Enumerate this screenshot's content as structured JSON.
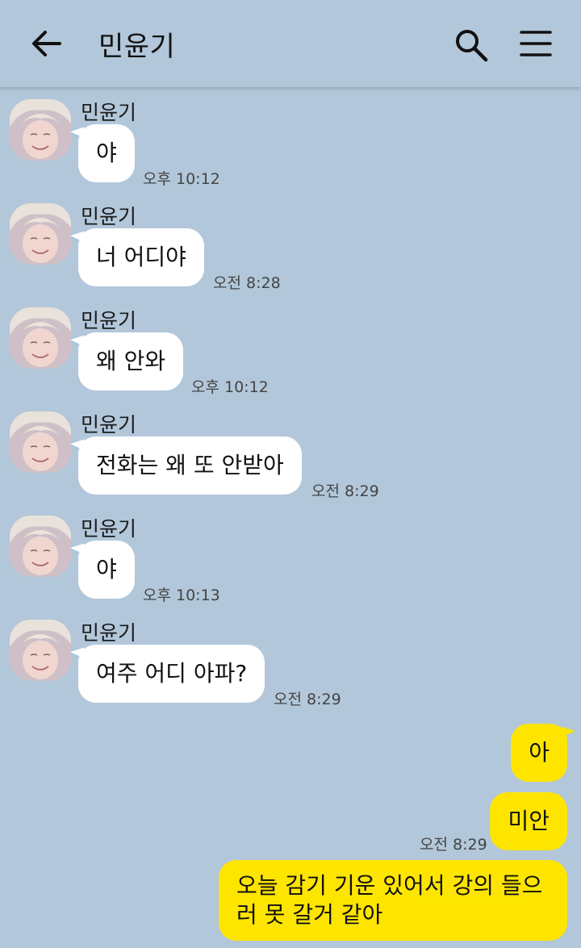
{
  "header": {
    "title": "민윤기"
  },
  "incoming": [
    {
      "sender": "민윤기",
      "text": "야",
      "time": "오후 10:12"
    },
    {
      "sender": "민윤기",
      "text": "너 어디야",
      "time": "오전 8:28"
    },
    {
      "sender": "민윤기",
      "text": "왜 안와",
      "time": "오후 10:12"
    },
    {
      "sender": "민윤기",
      "text": "전화는 왜 또 안받아",
      "time": "오전 8:29"
    },
    {
      "sender": "민윤기",
      "text": "야",
      "time": "오후 10:13"
    },
    {
      "sender": "민윤기",
      "text": "여주 어디 아파?",
      "time": "오전 8:29"
    }
  ],
  "outgoing": [
    {
      "text": "아"
    },
    {
      "text": "미안",
      "time": "오전 8:29"
    },
    {
      "text": "오늘 감기 기운 있어서 강의 들으러 못 갈거 같아"
    }
  ],
  "colors": {
    "background": "#b2c7da",
    "incoming_bubble": "#ffffff",
    "outgoing_bubble": "#fee500"
  },
  "icons": {
    "back": "arrow-left-icon",
    "search": "search-icon",
    "menu": "hamburger-menu-icon"
  }
}
